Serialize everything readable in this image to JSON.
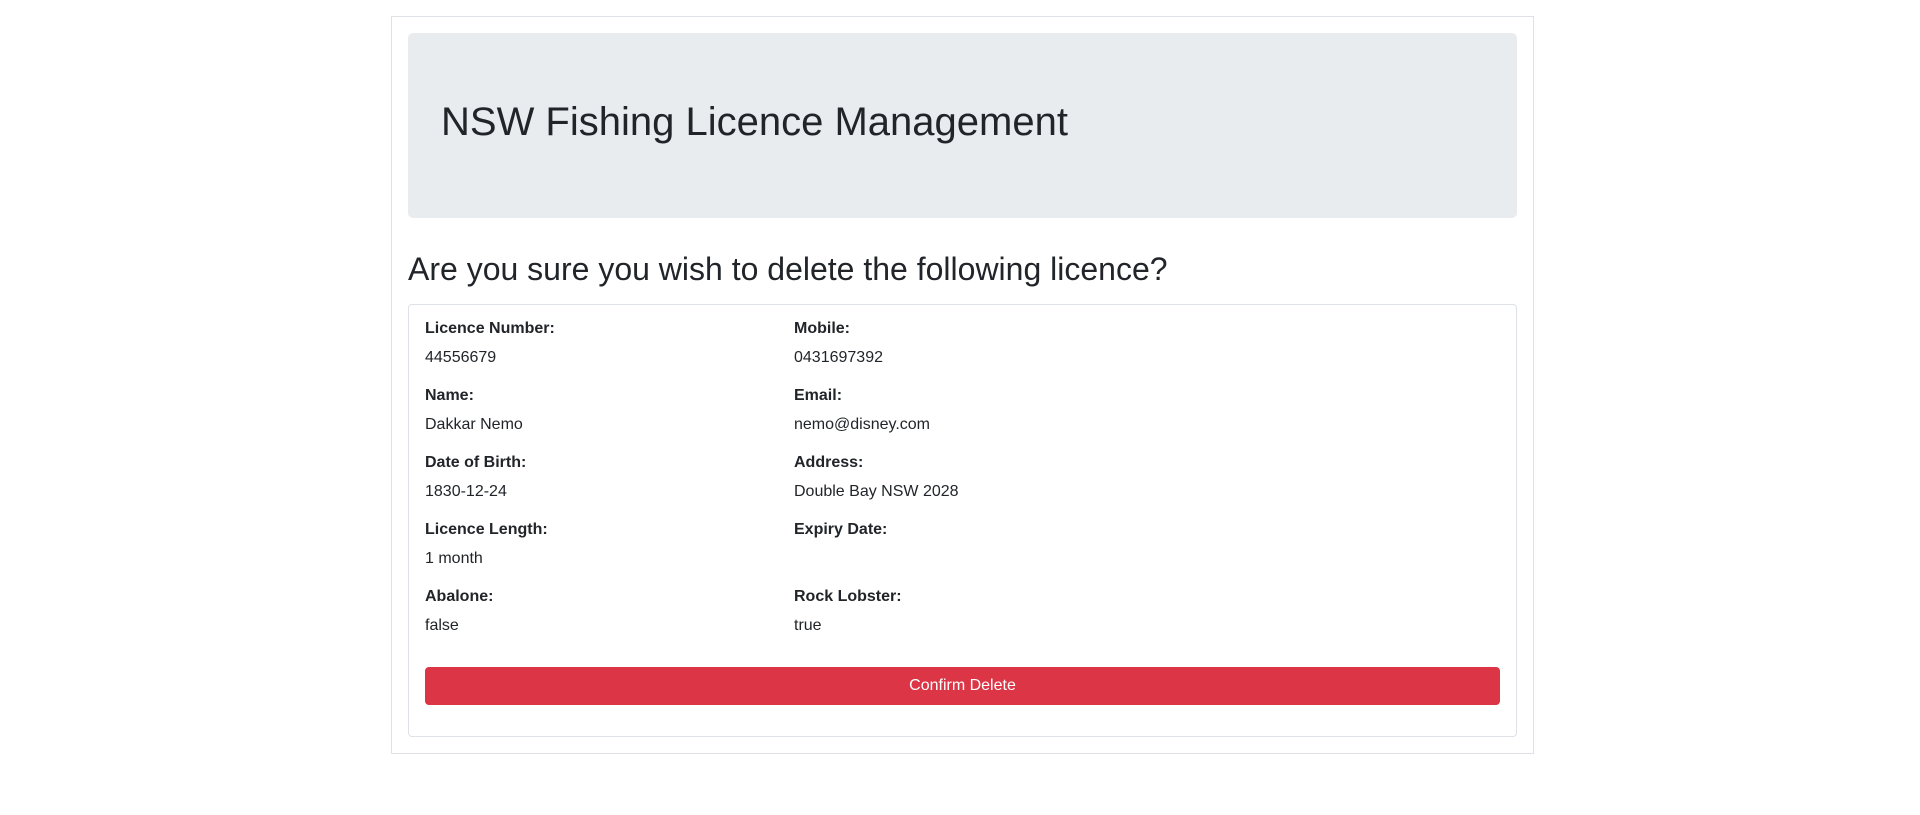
{
  "header": {
    "title": "NSW Fishing Licence Management"
  },
  "prompt": {
    "question": "Are you sure you wish to delete the following licence?"
  },
  "licence": {
    "licence_number": {
      "label": "Licence Number:",
      "value": "44556679"
    },
    "mobile": {
      "label": "Mobile:",
      "value": "0431697392"
    },
    "name": {
      "label": "Name:",
      "value": "Dakkar Nemo"
    },
    "email": {
      "label": "Email:",
      "value": "nemo@disney.com"
    },
    "date_of_birth": {
      "label": "Date of Birth:",
      "value": "1830-12-24"
    },
    "address": {
      "label": "Address:",
      "value": "Double Bay NSW 2028"
    },
    "licence_length": {
      "label": "Licence Length:",
      "value": "1 month"
    },
    "expiry_date": {
      "label": "Expiry Date:",
      "value": ""
    },
    "abalone": {
      "label": "Abalone:",
      "value": "false"
    },
    "rock_lobster": {
      "label": "Rock Lobster:",
      "value": "true"
    }
  },
  "actions": {
    "confirm_delete_label": "Confirm Delete"
  },
  "colors": {
    "danger": "#dc3545",
    "jumbotron_bg": "#e9ecef",
    "border": "#dee2e6",
    "text": "#212529"
  }
}
